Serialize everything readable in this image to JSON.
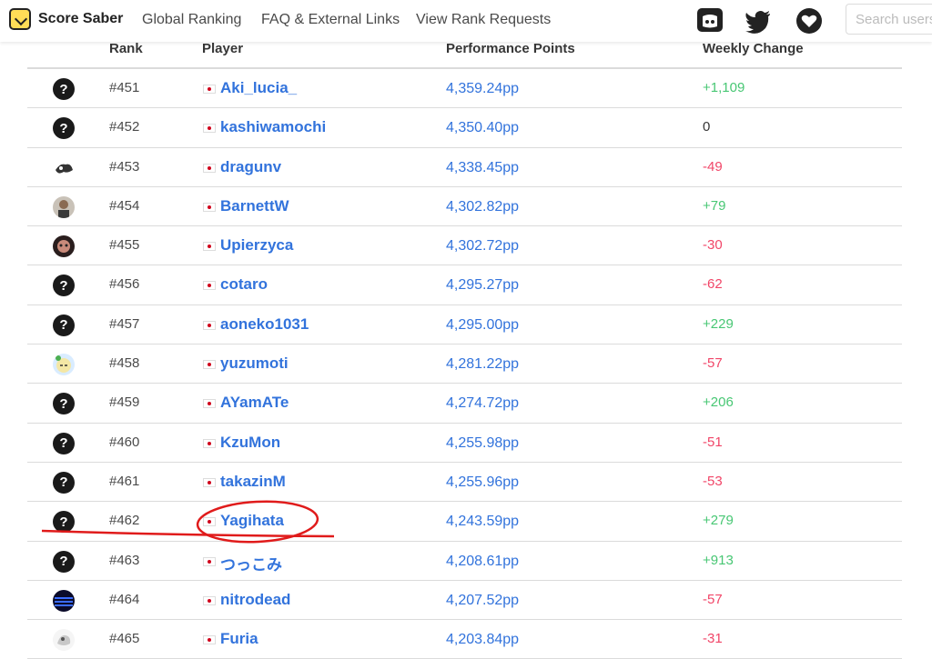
{
  "navbar": {
    "brand": "Score Saber",
    "links": [
      "Global Ranking",
      "FAQ & External Links",
      "View Rank Requests"
    ],
    "icons": [
      "discord-icon",
      "twitter-icon",
      "heart-icon"
    ],
    "search_placeholder": "Search users"
  },
  "table": {
    "headers": {
      "rank": "Rank",
      "player": "Player",
      "pp": "Performance Points",
      "change": "Weekly Change"
    },
    "rows": [
      {
        "avatar": "unknown",
        "rank": "#451",
        "player": "Aki_lucia_",
        "pp": "4,359.24pp",
        "change": "+1,109",
        "trend": "pos"
      },
      {
        "avatar": "unknown",
        "rank": "#452",
        "player": "kashiwamochi",
        "pp": "4,350.40pp",
        "change": "0",
        "trend": "zero"
      },
      {
        "avatar": "custom",
        "rank": "#453",
        "player": "dragunv",
        "pp": "4,338.45pp",
        "change": "-49",
        "trend": "neg"
      },
      {
        "avatar": "custom",
        "rank": "#454",
        "player": "BarnettW",
        "pp": "4,302.82pp",
        "change": "+79",
        "trend": "pos"
      },
      {
        "avatar": "custom",
        "rank": "#455",
        "player": "Upierzyca",
        "pp": "4,302.72pp",
        "change": "-30",
        "trend": "neg"
      },
      {
        "avatar": "unknown",
        "rank": "#456",
        "player": "cotaro",
        "pp": "4,295.27pp",
        "change": "-62",
        "trend": "neg"
      },
      {
        "avatar": "unknown",
        "rank": "#457",
        "player": "aoneko1031",
        "pp": "4,295.00pp",
        "change": "+229",
        "trend": "pos"
      },
      {
        "avatar": "custom",
        "rank": "#458",
        "player": "yuzumoti",
        "pp": "4,281.22pp",
        "change": "-57",
        "trend": "neg"
      },
      {
        "avatar": "unknown",
        "rank": "#459",
        "player": "AYamATe",
        "pp": "4,274.72pp",
        "change": "+206",
        "trend": "pos"
      },
      {
        "avatar": "unknown",
        "rank": "#460",
        "player": "KzuMon",
        "pp": "4,255.98pp",
        "change": "-51",
        "trend": "neg"
      },
      {
        "avatar": "unknown",
        "rank": "#461",
        "player": "takazinM",
        "pp": "4,255.96pp",
        "change": "-53",
        "trend": "neg"
      },
      {
        "avatar": "unknown",
        "rank": "#462",
        "player": "Yagihata",
        "pp": "4,243.59pp",
        "change": "+279",
        "trend": "pos"
      },
      {
        "avatar": "unknown",
        "rank": "#463",
        "player": "つっこみ",
        "pp": "4,208.61pp",
        "change": "+913",
        "trend": "pos"
      },
      {
        "avatar": "custom",
        "rank": "#464",
        "player": "nitrodead",
        "pp": "4,207.52pp",
        "change": "-57",
        "trend": "neg"
      },
      {
        "avatar": "custom",
        "rank": "#465",
        "player": "Furia",
        "pp": "4,203.84pp",
        "change": "-31",
        "trend": "neg"
      }
    ]
  },
  "colors": {
    "link": "#3273dc",
    "positive": "#48c774",
    "negative": "#f14668",
    "annotation": "#e01b1b"
  }
}
